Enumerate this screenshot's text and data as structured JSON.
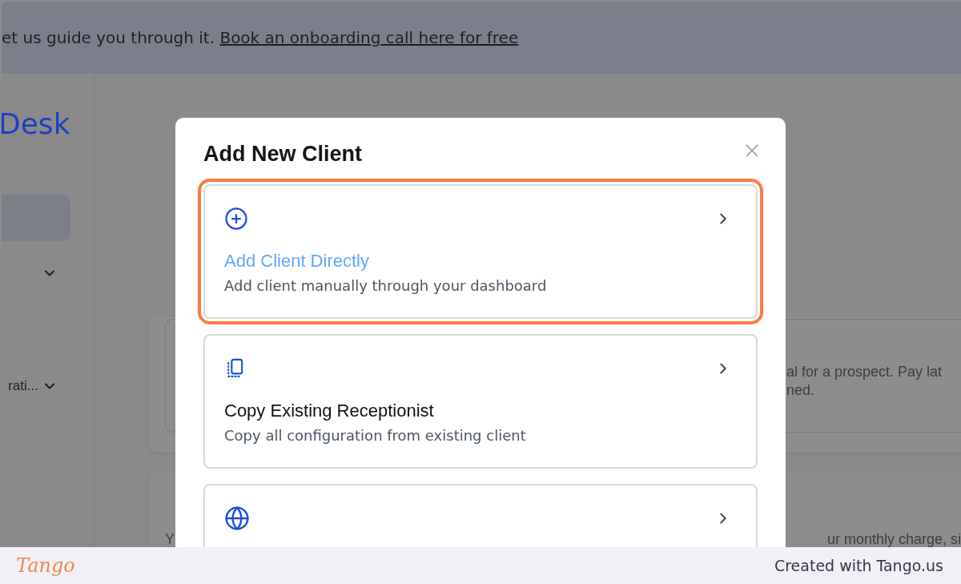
{
  "banner": {
    "text": "et us guide you through it. ",
    "link": "Book an onboarding call here for free"
  },
  "sidebar": {
    "logo": "Desk",
    "items": [
      {
        "selected": true
      },
      {
        "selected": false,
        "expanded": false
      },
      {
        "label": "rati...",
        "selected": false,
        "expanded": false
      }
    ]
  },
  "cards": [
    {
      "kind": "bordered",
      "lines": [
        "al for a prospect. Pay lat",
        "ned."
      ]
    },
    {
      "kind": "plain",
      "lines": [
        "Y"
      ],
      "tail": "ur monthly charge, si"
    }
  ],
  "modal": {
    "title": "Add New Client",
    "options": [
      {
        "kind": "direct",
        "title": "Add Client Directly",
        "subtitle": "Add client manually through your dashboard",
        "selected": true
      },
      {
        "kind": "copy",
        "title": "Copy Existing Receptionist",
        "subtitle": "Copy all configuration from existing client",
        "selected": false
      },
      {
        "kind": "web",
        "selected": false
      }
    ]
  },
  "footer": {
    "logo": "Tango",
    "credit": "Created with Tango.us"
  }
}
